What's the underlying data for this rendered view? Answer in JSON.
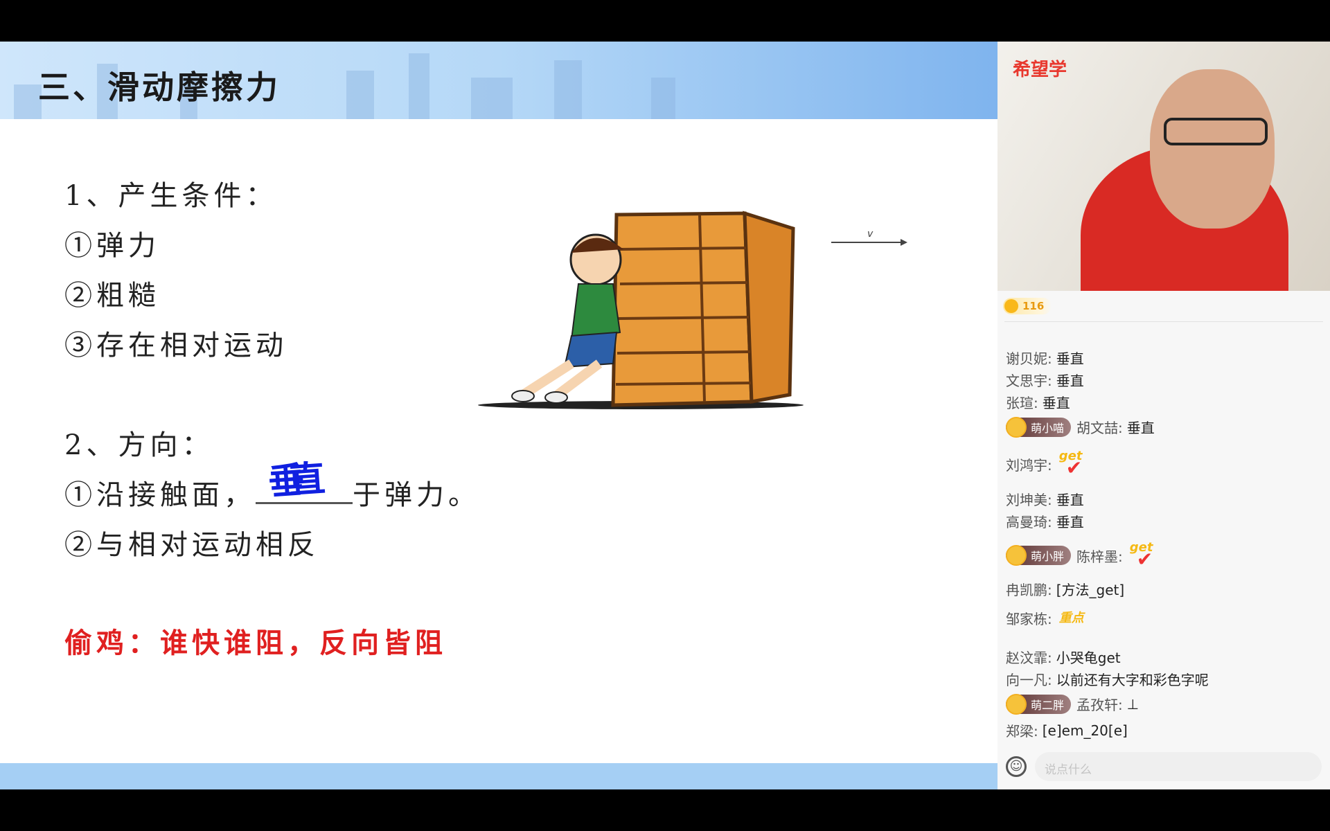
{
  "slide": {
    "title": "三、滑动摩擦力",
    "conditions_heading": "1、产生条件：",
    "conditions": [
      "①弹力",
      "②粗糙",
      "③存在相对运动"
    ],
    "direction_heading": "2、方向：",
    "direction_1_prefix": "①沿接触面，",
    "direction_1_handwritten": "垂直",
    "direction_1_suffix": "于弹力。",
    "direction_2": "②与相对运动相反",
    "tip": "偷鸡：谁快谁阻，反向皆阻",
    "velocity_label": "v"
  },
  "video": {
    "logo": "希望学"
  },
  "chat": {
    "coin_count": "116",
    "messages": [
      {
        "user": "谢贝妮:",
        "text": "垂直"
      },
      {
        "user": "文思宇:",
        "text": "垂直"
      },
      {
        "user": "张瑄:",
        "text": "垂直"
      },
      {
        "badge": "萌小喵",
        "user": "胡文喆:",
        "text": "垂直"
      },
      {
        "user": "刘鸿宇:",
        "sticker": "get"
      },
      {
        "user": "刘坤美:",
        "text": "垂直"
      },
      {
        "user": "高曼琦:",
        "text": "垂直"
      },
      {
        "badge": "萌小胖",
        "user": "陈梓墨:",
        "sticker": "get"
      },
      {
        "user": "冉凯鹏:",
        "text": "[方法_get]"
      },
      {
        "user": "邹家栋:",
        "sticker": "重点"
      },
      {
        "user": "赵汶霏:",
        "text": "小哭龟get"
      },
      {
        "user": "向一凡:",
        "text": "以前还有大字和彩色字呢"
      },
      {
        "badge": "萌二胖",
        "user": "孟孜轩:",
        "text": "⊥"
      },
      {
        "user": "郑梁:",
        "text": "[e]em_20[e]"
      }
    ],
    "input_placeholder": "说点什么"
  }
}
